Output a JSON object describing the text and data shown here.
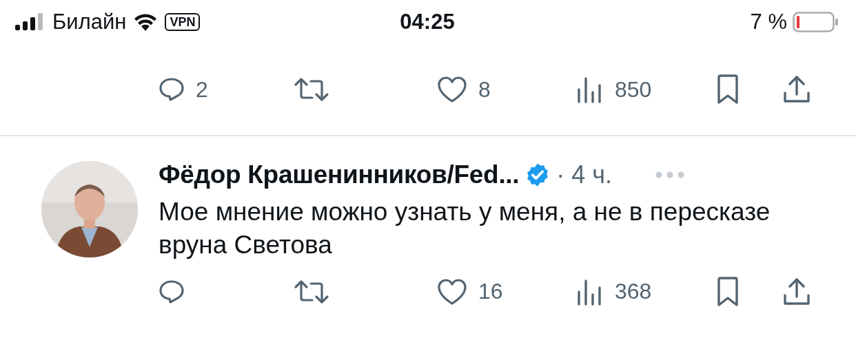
{
  "status_bar": {
    "carrier": "Билайн",
    "vpn": "VPN",
    "time": "04:25",
    "battery": "7 %"
  },
  "previous_post": {
    "actions": {
      "replies": "2",
      "likes": "8",
      "views": "850"
    }
  },
  "post": {
    "author": "Фёдор Крашенинников/Fed...",
    "verified": true,
    "time": "· 4 ч.",
    "text": "Мое мнение можно узнать у меня, а не в пересказе вруна Светова",
    "actions": {
      "likes": "16",
      "views": "368"
    }
  }
}
